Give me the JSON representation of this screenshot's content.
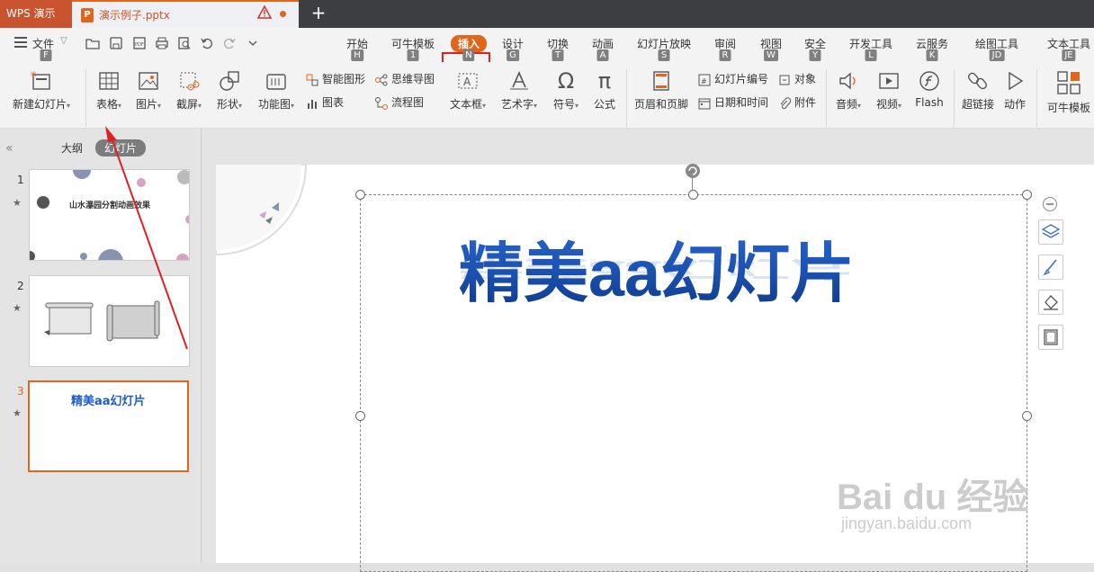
{
  "app": {
    "name": "WPS 演示"
  },
  "document_tab": {
    "icon_letter": "P",
    "filename": "演示例子.pptx"
  },
  "menu": {
    "file_label": "文件",
    "file_key": "F"
  },
  "ribbon_tabs": [
    {
      "label": "开始",
      "key": "H",
      "active": false
    },
    {
      "label": "可牛模板",
      "key": "1",
      "active": false
    },
    {
      "label": "插入",
      "key": "N",
      "active": true
    },
    {
      "label": "设计",
      "key": "G",
      "active": false
    },
    {
      "label": "切换",
      "key": "T",
      "active": false
    },
    {
      "label": "动画",
      "key": "A",
      "active": false
    },
    {
      "label": "幻灯片放映",
      "key": "S",
      "active": false
    },
    {
      "label": "审阅",
      "key": "R",
      "active": false
    },
    {
      "label": "视图",
      "key": "W",
      "active": false
    },
    {
      "label": "安全",
      "key": "Y",
      "active": false
    },
    {
      "label": "开发工具",
      "key": "L",
      "active": false
    },
    {
      "label": "云服务",
      "key": "K",
      "active": false
    },
    {
      "label": "绘图工具",
      "key": "JD",
      "active": false
    },
    {
      "label": "文本工具",
      "key": "JE",
      "active": false
    }
  ],
  "ribbon": {
    "new_slide": "新建幻灯片",
    "table": "表格",
    "picture": "图片",
    "screenshot": "截屏",
    "shape": "形状",
    "function_chart": "功能图",
    "smart_shape": "智能图形",
    "chart": "图表",
    "mind_map": "思维导图",
    "flowchart": "流程图",
    "textbox": "文本框",
    "wordart": "艺术字",
    "symbol": "符号",
    "formula": "公式",
    "header_footer": "页眉和页脚",
    "slide_number": "幻灯片编号",
    "date_time": "日期和时间",
    "object": "对象",
    "attachment": "附件",
    "audio": "音频",
    "video": "视频",
    "flash": "Flash",
    "hyperlink": "超链接",
    "action": "动作",
    "kn_template": "可牛模板"
  },
  "left_panel": {
    "tab_outline": "大纲",
    "tab_slides": "幻灯片",
    "slides": [
      {
        "num": "1",
        "title": "山水瀑园分割动画效果"
      },
      {
        "num": "2",
        "title": ""
      },
      {
        "num": "3",
        "title": "精美aa幻灯片"
      }
    ]
  },
  "slide": {
    "title": "精美aa幻灯片"
  },
  "watermark": {
    "brand": "Bai du 经验",
    "url": "jingyan.baidu.com"
  }
}
